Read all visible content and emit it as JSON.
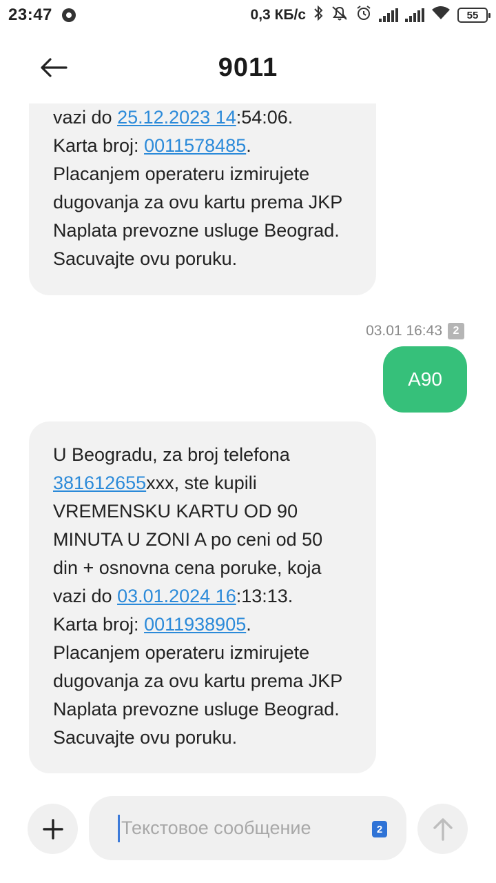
{
  "status_bar": {
    "time": "23:47",
    "network_speed": "0,3 КБ/с",
    "battery": "55",
    "icons": [
      "chrome-icon",
      "bluetooth-icon",
      "mute-icon",
      "alarm-icon",
      "signal-icon",
      "signal-icon",
      "wifi-icon",
      "battery-icon"
    ]
  },
  "header": {
    "title": "9011",
    "back_icon": "arrow-left-icon"
  },
  "messages": {
    "first": {
      "part1": "vazi do ",
      "link1": "25.12.2023 14",
      "part2": ":54:06.",
      "part3": "Karta broj: ",
      "link2": "0011578485",
      "part4": ".",
      "part5": "Placanjem operateru izmirujete dugovanja za ovu kartu prema JKP Naplata prevozne usluge Beograd. Sacuvajte ovu poruku."
    },
    "sent": {
      "timestamp": "03.01 16:43",
      "sim": "2",
      "text": "A90"
    },
    "second": {
      "part1": "U Beogradu, za broj telefona ",
      "link1": "381612655",
      "part2": "xxx, ste kupili VREMENSKU KARTU OD 90 MINUTA U ZONI A po ceni od 50 din + osnovna cena poruke, koja vazi do ",
      "link2": "03.01.2024 16",
      "part3": ":13:13.",
      "part4": "Karta broj: ",
      "link3": "0011938905",
      "part5": ".",
      "part6": "Placanjem operateru izmirujete dugovanja za ovu kartu prema JKP Naplata prevozne usluge Beograd. Sacuvajte ovu poruku."
    }
  },
  "composer": {
    "placeholder": "Текстовое сообщение",
    "sim": "2",
    "add_icon": "plus-icon",
    "send_icon": "arrow-up-icon"
  },
  "colors": {
    "sent_bubble": "#36c07a",
    "received_bubble": "#f2f2f2",
    "link": "#2b8ad9"
  }
}
